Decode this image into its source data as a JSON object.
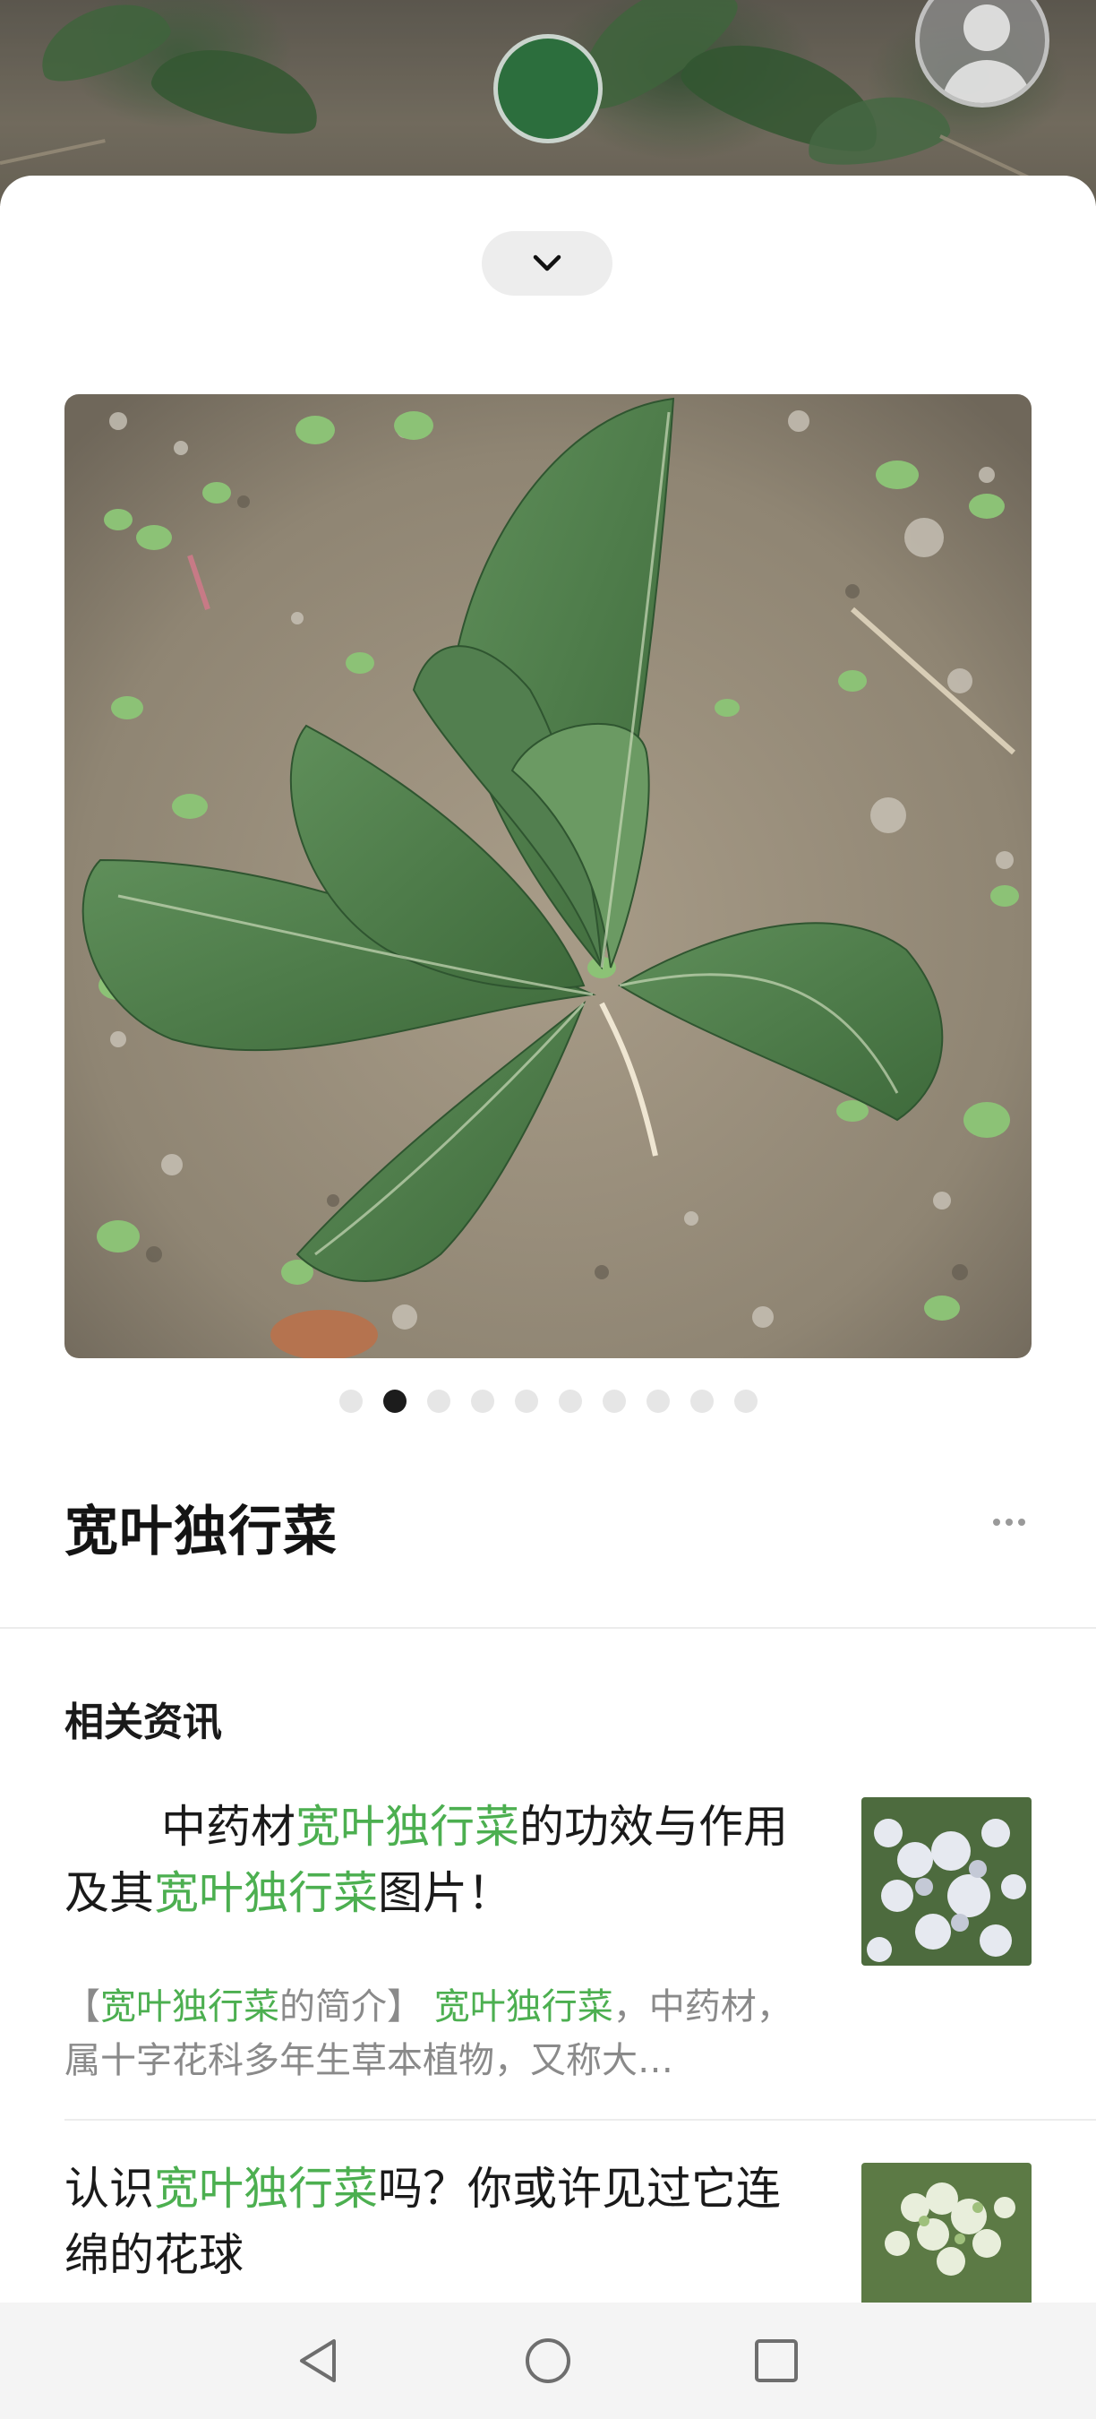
{
  "plant": {
    "name": "宽叶独行菜"
  },
  "carousel": {
    "page_count": 10,
    "active_index": 1
  },
  "related": {
    "section_title": "相关资讯",
    "articles": [
      {
        "headline": [
          {
            "text": "中药材",
            "hl": false
          },
          {
            "text": "宽叶独行菜",
            "hl": true
          },
          {
            "text": "的功效与作用及其",
            "hl": false
          },
          {
            "text": "宽叶独行菜",
            "hl": true
          },
          {
            "text": "图片！",
            "hl": false
          }
        ],
        "summary": [
          {
            "text": "【",
            "hl": false
          },
          {
            "text": "宽叶独行菜",
            "hl": true
          },
          {
            "text": "的简介】 ",
            "hl": false
          },
          {
            "text": "宽叶独行菜",
            "hl": true
          },
          {
            "text": "，中药材，属十字花科多年生草本植物，又称大…",
            "hl": false
          }
        ]
      },
      {
        "headline": [
          {
            "text": "认识",
            "hl": false
          },
          {
            "text": "宽叶独行菜",
            "hl": true
          },
          {
            "text": "吗？你或许见过它连绵的花球",
            "hl": false
          }
        ]
      }
    ]
  },
  "colors": {
    "highlight": "#4caf50",
    "capture_button": "#2c6e3d",
    "pager_active": "#1c1c1c",
    "pager_inactive": "#e6e6e6"
  },
  "icons": {
    "collapse": "chevron-down-icon",
    "more": "more-dots-icon",
    "profile": "user-avatar-icon",
    "nav_back": "triangle-back-icon",
    "nav_home": "circle-home-icon",
    "nav_recents": "square-recents-icon"
  }
}
